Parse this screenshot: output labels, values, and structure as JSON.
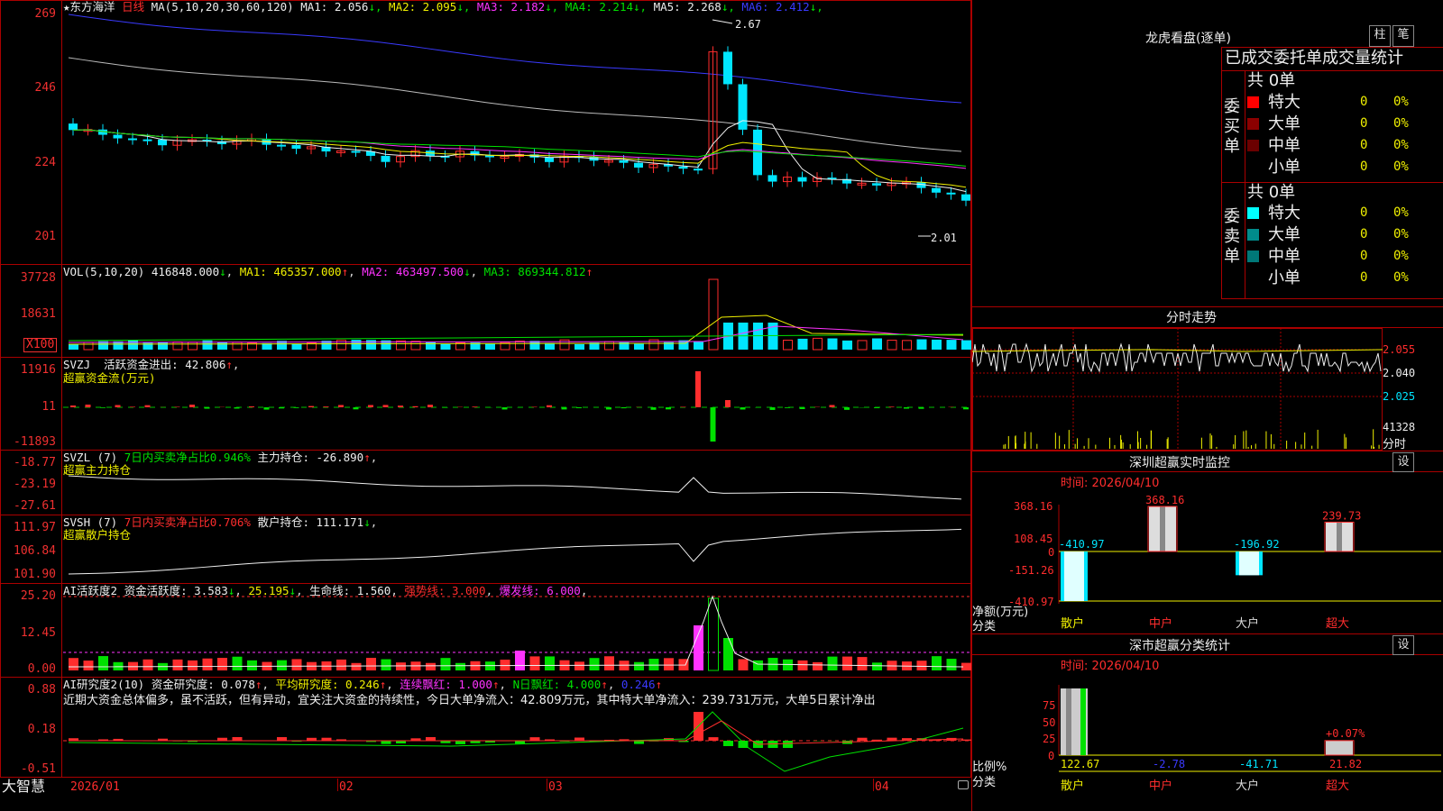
{
  "main": {
    "stock_name": "东方海洋",
    "period": "日线",
    "ma_header": "MA(5,10,20,30,60,120)",
    "ma": [
      {
        "label": "MA1: 2.056",
        "arrow": "↓",
        "color": "#eeeeee"
      },
      {
        "label": "MA2: 2.095",
        "arrow": "↓",
        "color": "#f0f000"
      },
      {
        "label": "MA3: 2.182",
        "arrow": "↓",
        "color": "#ff33ff"
      },
      {
        "label": "MA4: 2.214",
        "arrow": "↓",
        "color": "#00e000"
      },
      {
        "label": "MA5: 2.268",
        "arrow": "↓",
        "color": "#eeeeee"
      },
      {
        "label": "MA6: 2.412",
        "arrow": "↓",
        "color": "#3a3aff"
      }
    ],
    "y_ticks": [
      "269",
      "246",
      "224",
      "201"
    ],
    "high_label": "2.67",
    "low_label": "2.01"
  },
  "vol": {
    "header": "VOL(5,10,20)",
    "value": "416848.000",
    "ma1": "MA1: 465357.000",
    "ma2": "MA2: 463497.500",
    "ma3": "MA3: 869344.812",
    "y_ticks": [
      "37728",
      "18631"
    ],
    "unit": "X100"
  },
  "svzj": {
    "name": "SVZJ",
    "label": "活跃资金进出: 42.806",
    "title": "超赢资金流(万元)",
    "y_ticks": [
      "11916",
      "11",
      "-11893"
    ]
  },
  "svzl": {
    "name": "SVZL (7)",
    "ratio": "7日内买卖净占比0.946%",
    "hold": "主力持仓: -26.890",
    "title": "超赢主力持仓",
    "y_ticks": [
      "-18.77",
      "-23.19",
      "-27.61"
    ]
  },
  "svsh": {
    "name": "SVSH (7)",
    "ratio": "7日内买卖净占比0.706%",
    "hold": "散户持仓: 111.171",
    "title": "超赢散户持仓",
    "y_ticks": [
      "111.97",
      "106.84",
      "101.90"
    ]
  },
  "ai2": {
    "name": "AI活跃度2",
    "active": "资金活跃度: 3.583",
    "v2": "25.195",
    "life": "生命线: 1.560",
    "strong": "强势线: 3.000",
    "burst": "爆发线: 6.000",
    "y_ticks": [
      "25.20",
      "12.45",
      "0.00"
    ]
  },
  "ai_research": {
    "name": "AI研究度2(10)",
    "research": "资金研究度: 0.078",
    "avg": "平均研究度: 0.246",
    "cont": "连续飘红: 1.000",
    "nday": "N日飘红: 4.000",
    "last": "0.246",
    "commentary": "近期大资金总体偏多，虽不活跃，但有异动，宜关注大资金的持续性，今日大单净流入：42.809万元，其中特大单净流入：239.731万元，大单5日累计净出",
    "y_ticks": [
      "0.88",
      "0.18",
      "-0.51"
    ]
  },
  "footer": {
    "brand": "大智慧",
    "dates": [
      "2026/01",
      "02",
      "03",
      "04"
    ]
  },
  "lhb": {
    "title": "龙虎看盘(逐单)",
    "btn1": "柱",
    "btn2": "笔",
    "subtitle": "已成交委托单成交量统计",
    "buy": {
      "side": "委买单",
      "total": "共 0单",
      "rows": [
        {
          "label": "特大",
          "count": "0",
          "pct": "0%",
          "color": "#ff0000"
        },
        {
          "label": "大单",
          "count": "0",
          "pct": "0%",
          "color": "#8b0000"
        },
        {
          "label": "中单",
          "count": "0",
          "pct": "0%",
          "color": "#6b0000"
        },
        {
          "label": "小单",
          "count": "0",
          "pct": "0%",
          "color": ""
        }
      ]
    },
    "sell": {
      "side": "委卖单",
      "total": "共 0单",
      "rows": [
        {
          "label": "特大",
          "count": "0",
          "pct": "0%",
          "color": "#00ffff"
        },
        {
          "label": "大单",
          "count": "0",
          "pct": "0%",
          "color": "#008b8b"
        },
        {
          "label": "中单",
          "count": "0",
          "pct": "0%",
          "color": "#007878"
        },
        {
          "label": "小单",
          "count": "0",
          "pct": "0%",
          "color": ""
        }
      ]
    }
  },
  "intraday": {
    "title": "分时走势",
    "prices": [
      "2.055",
      "2.040",
      "2.025"
    ],
    "vol": "41328",
    "vol_unit": "分时"
  },
  "sz_monitor": {
    "title": "深圳超赢实时监控",
    "btn": "设",
    "time": "时间: 2026/04/10",
    "y_ticks": [
      "368.16",
      "108.45",
      "0",
      "-151.26",
      "-410.97"
    ],
    "ylabel_1": "净额(万元)",
    "ylabel_2": "分类",
    "categories": [
      "散户",
      "中户",
      "大户",
      "超大"
    ]
  },
  "sz_class": {
    "title": "深市超赢分类统计",
    "btn": "设",
    "time": "时间: 2026/04/10",
    "y_ticks": [
      "75",
      "50",
      "25",
      "0"
    ],
    "ylabel_1": "比例%",
    "ylabel_2": "分类",
    "categories": [
      "散户",
      "中户",
      "大户",
      "超大"
    ]
  },
  "chart_data": [
    {
      "type": "bar",
      "title": "深圳超赢实时监控",
      "ylabel": "净额(万元)",
      "xlabel": "分类",
      "categories": [
        "散户",
        "中户",
        "大户",
        "超大"
      ],
      "values": [
        -410.97,
        368.16,
        -196.92,
        239.73
      ],
      "ylim": [
        -410.97,
        368.16
      ]
    },
    {
      "type": "bar",
      "title": "深市超赢分类统计",
      "ylabel": "比例%",
      "xlabel": "分类",
      "categories": [
        "散户",
        "中户",
        "大户",
        "超大"
      ],
      "values": [
        122.67,
        -2.78,
        -41.71,
        21.82
      ],
      "annotation": "+0.07%",
      "ylim": [
        0,
        100
      ]
    }
  ]
}
